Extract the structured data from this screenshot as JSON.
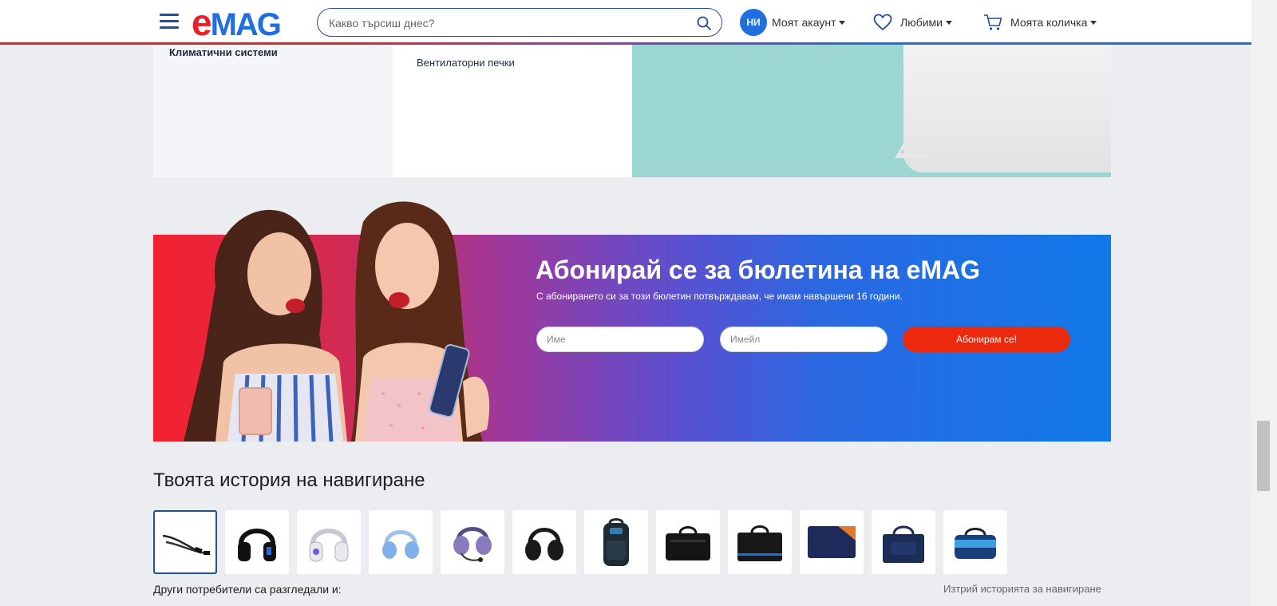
{
  "header": {
    "logo_e": "e",
    "logo_mag": "MAG",
    "search_placeholder": "Какво търсиш днес?",
    "avatar_initials": "НИ",
    "account_label": "Моят акаунт",
    "favorites_label": "Любими",
    "cart_label": "Моята количка"
  },
  "category_panel": {
    "title": "Климатични системи",
    "link": "Вентилаторни печки"
  },
  "newsletter": {
    "title": "Абонирай се за бюлетина на eMAG",
    "subtitle": "С абонирането си за този бюлетин потвърждавам, че имам навършени 16 години.",
    "name_placeholder": "Име",
    "email_placeholder": "Имейл",
    "button_label": "Абонирам се!"
  },
  "history": {
    "title": "Твоята история на навигиране",
    "items": [
      {
        "icon": "cable-icon"
      },
      {
        "icon": "gaming-headset-icon"
      },
      {
        "icon": "white-headset-icon"
      },
      {
        "icon": "blue-headphones-icon"
      },
      {
        "icon": "purple-headset-icon"
      },
      {
        "icon": "black-headphones-icon"
      },
      {
        "icon": "backpack-icon"
      },
      {
        "icon": "laptop-bag-icon"
      },
      {
        "icon": "laptop-bag-blue-trim-icon"
      },
      {
        "icon": "laptop-sleeve-icon"
      },
      {
        "icon": "navy-laptop-bag-icon"
      },
      {
        "icon": "duffel-bag-icon"
      }
    ],
    "others_viewed": "Други потребители са разгледали и:",
    "clear_label": "Изтрий историята за навигиране"
  },
  "colors": {
    "brand_red": "#e8202a",
    "brand_blue": "#1f6fe0",
    "subscribe_button": "#ec2a0e"
  }
}
